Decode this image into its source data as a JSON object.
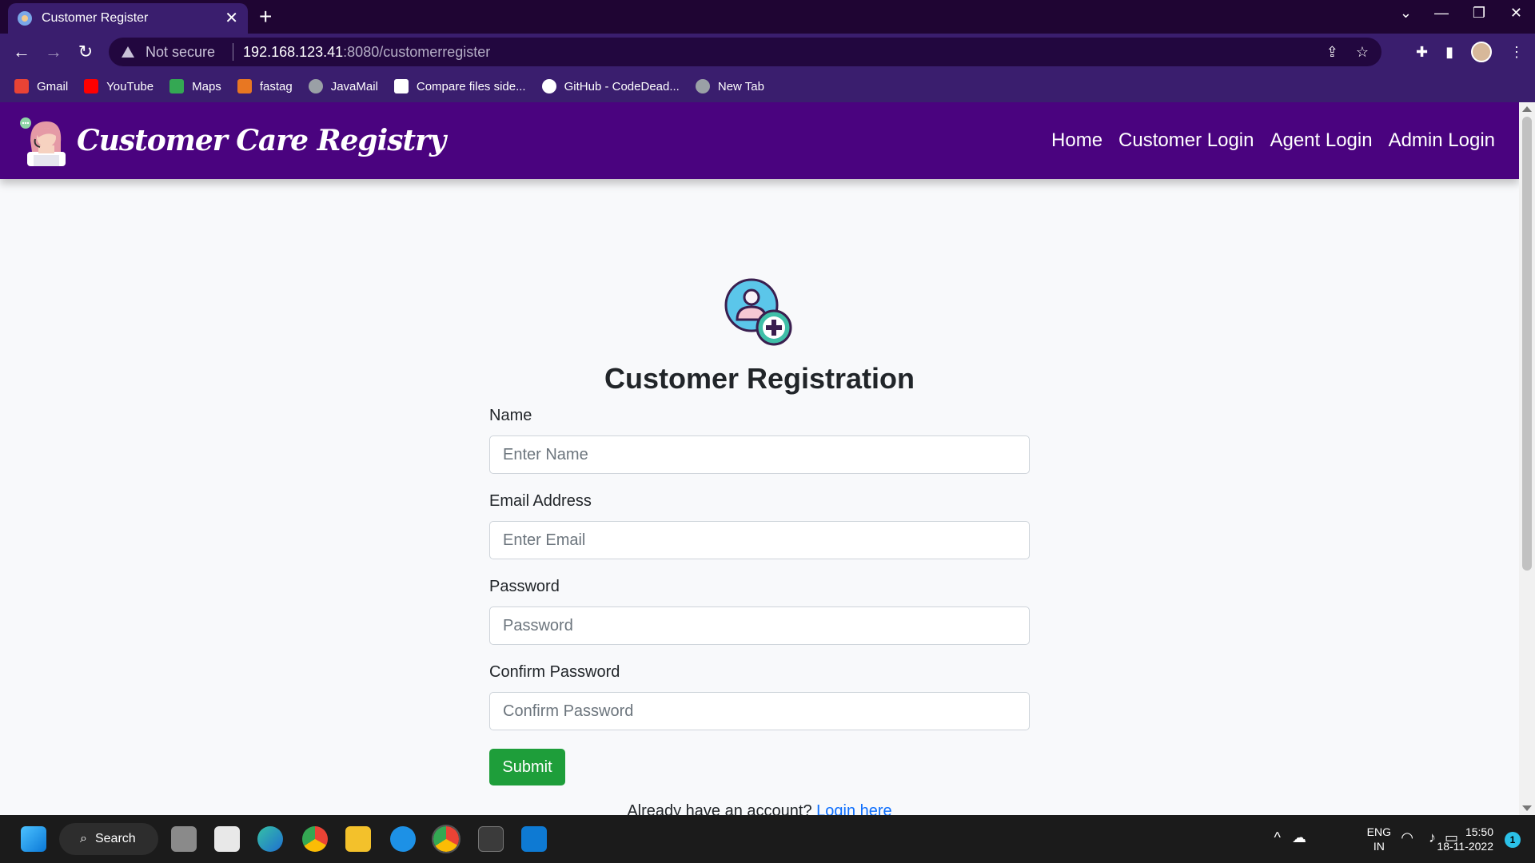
{
  "browser": {
    "tab_title": "Customer Register",
    "tab_close": "✕",
    "new_tab": "+",
    "security_label": "Not secure",
    "url_host": "192.168.123.41",
    "url_path": ":8080/customerregister",
    "bookmarks": [
      {
        "label": "Gmail",
        "color": "#ea4335"
      },
      {
        "label": "YouTube",
        "color": "#ff0000"
      },
      {
        "label": "Maps",
        "color": "#34a853"
      },
      {
        "label": "fastag",
        "color": "#e87722"
      },
      {
        "label": "JavaMail",
        "color": "#9aa0a6"
      },
      {
        "label": "Compare files side...",
        "color": "#ffffff"
      },
      {
        "label": "GitHub - CodeDead...",
        "color": "#ffffff"
      },
      {
        "label": "New Tab",
        "color": "#9aa0a6"
      }
    ]
  },
  "navbar": {
    "brand": "Customer Care Registry",
    "links": [
      "Home",
      "Customer Login",
      "Agent Login",
      "Admin Login"
    ]
  },
  "form": {
    "title": "Customer Registration",
    "name_label": "Name",
    "name_placeholder": "Enter Name",
    "email_label": "Email Address",
    "email_placeholder": "Enter Email",
    "password_label": "Password",
    "password_placeholder": "Password",
    "confirm_label": "Confirm Password",
    "confirm_placeholder": "Confirm Password",
    "submit": "Submit",
    "already_text": "Already have an account?",
    "login_link": "Login here"
  },
  "taskbar": {
    "search_label": "Search",
    "lang_line1": "ENG",
    "lang_line2": "IN",
    "time": "15:50",
    "date": "18-11-2022",
    "notification_count": "1"
  },
  "colors": {
    "navbar": "#4a037f",
    "submit": "#1e9e3a",
    "link": "#0d6efd"
  }
}
